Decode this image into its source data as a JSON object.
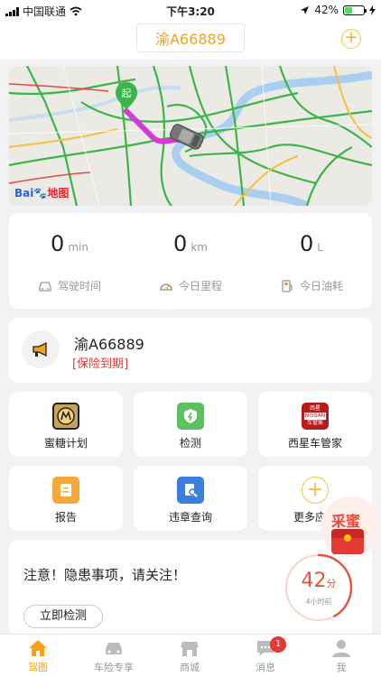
{
  "status_bar": {
    "carrier": "中国联通",
    "time": "下午3:20",
    "battery": "42%",
    "battery_level": 0.42
  },
  "header": {
    "plate": "渝A66889"
  },
  "map": {
    "start_marker": "起",
    "logo_text": "Bai",
    "logo_text2": "地图"
  },
  "stats": [
    {
      "value": "0",
      "unit": "min",
      "label": "驾驶时间",
      "icon": "car-icon"
    },
    {
      "value": "0",
      "unit": "km",
      "label": "今日里程",
      "icon": "speedometer-icon"
    },
    {
      "value": "0",
      "unit": "L",
      "label": "今日油耗",
      "icon": "fuel-icon"
    }
  ],
  "vehicle": {
    "plate": "渝A66889",
    "warning": "[保险到期]"
  },
  "grid": [
    {
      "label": "蜜糖计划",
      "icon": "honey-plan-icon"
    },
    {
      "label": "检测",
      "icon": "shield-check-icon"
    },
    {
      "label": "西星车管家",
      "icon": "nissan-logo-icon",
      "logo_top": "西星",
      "logo_mid": "NISSAN",
      "logo_bottom": "车管家"
    },
    {
      "label": "报告",
      "icon": "report-icon"
    },
    {
      "label": "违章查询",
      "icon": "violation-search-icon"
    },
    {
      "label": "更多应用",
      "icon": "plus-circle-icon"
    }
  ],
  "notice": {
    "text": "注意！隐患事项，请关注！",
    "button": "立即检测",
    "score": "42",
    "score_unit": "分",
    "score_time": "4小时前",
    "score_value": 42
  },
  "floating": {
    "label": "采蜜"
  },
  "tabs": [
    {
      "label": "驾图",
      "icon": "home-icon",
      "active": true
    },
    {
      "label": "车险专享",
      "icon": "car-insurance-icon"
    },
    {
      "label": "商城",
      "icon": "shop-icon"
    },
    {
      "label": "消息",
      "icon": "message-icon",
      "badge": "1"
    },
    {
      "label": "我",
      "icon": "user-icon"
    }
  ],
  "colors": {
    "accent": "#f5a21b",
    "warning": "#e53935",
    "route": "#d63ad6",
    "traffic": "#3bb54a"
  }
}
